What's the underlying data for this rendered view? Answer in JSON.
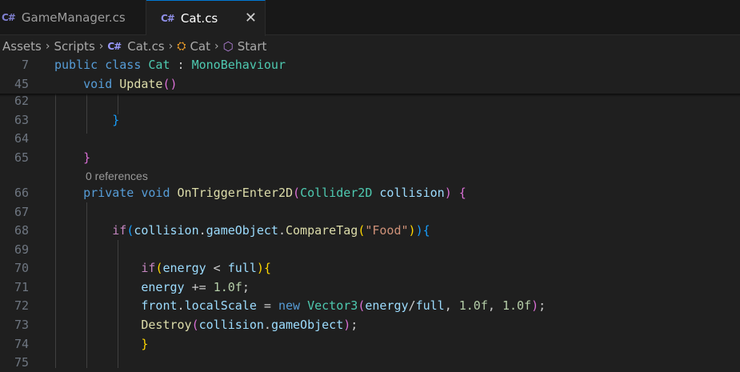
{
  "tabs": [
    {
      "label": "GameManager.cs",
      "icon": "csharp-icon",
      "active": false
    },
    {
      "label": "Cat.cs",
      "icon": "csharp-icon",
      "active": true
    }
  ],
  "icons": {
    "csharp": "C#",
    "close": "✕",
    "class": "⛭",
    "method": "⬡",
    "chevron": "›"
  },
  "breadcrumb": {
    "items": [
      "Assets",
      "Scripts",
      "Cat.cs",
      "Cat",
      "Start"
    ]
  },
  "sticky": [
    {
      "num": "7"
    },
    {
      "num": "45"
    }
  ],
  "code_lines": [
    {
      "num": "62"
    },
    {
      "num": "63"
    },
    {
      "num": "64"
    },
    {
      "num": "65"
    },
    {
      "num": "66"
    },
    {
      "num": "67"
    },
    {
      "num": "68"
    },
    {
      "num": "69"
    },
    {
      "num": "70"
    },
    {
      "num": "71"
    },
    {
      "num": "72"
    },
    {
      "num": "73"
    },
    {
      "num": "74"
    },
    {
      "num": "75"
    }
  ],
  "codelens": "0 references",
  "colors": {
    "active_tab_border": "#0078d4",
    "editor_bg": "#1f1f1f"
  }
}
